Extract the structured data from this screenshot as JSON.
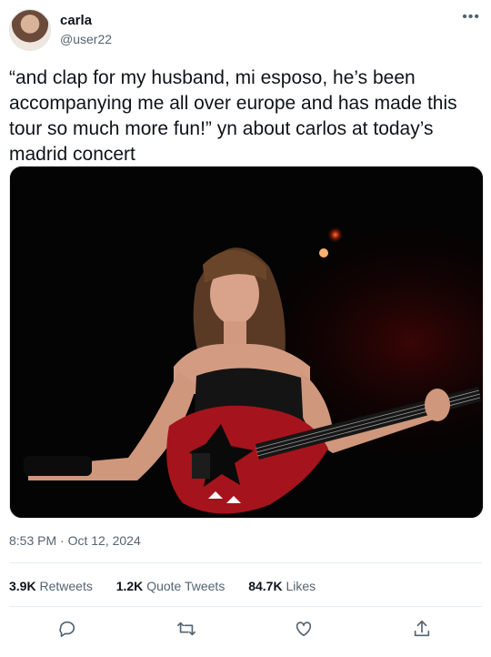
{
  "user": {
    "name": "carla",
    "handle": "@user22"
  },
  "more_icon": "more-options-icon",
  "tweet": {
    "text": "“and clap for my husband, mi esposo, he’s been accompanying me all over europe and has made this tour so much more fun!” yn about carlos at today’s madrid concert"
  },
  "timestamp": "8:53 PM · Oct 12, 2024",
  "stats": [
    {
      "count": "3.9K",
      "label": "Retweets"
    },
    {
      "count": "1.2K",
      "label": "Quote Tweets"
    },
    {
      "count": "84.7K",
      "label": "Likes"
    }
  ],
  "actions": [
    "reply-icon",
    "retweet-icon",
    "like-icon",
    "share-icon"
  ],
  "colors": {
    "text": "#0f1419",
    "muted": "#536471",
    "divider": "#e6ecf0",
    "guitar": "#a5141c"
  }
}
